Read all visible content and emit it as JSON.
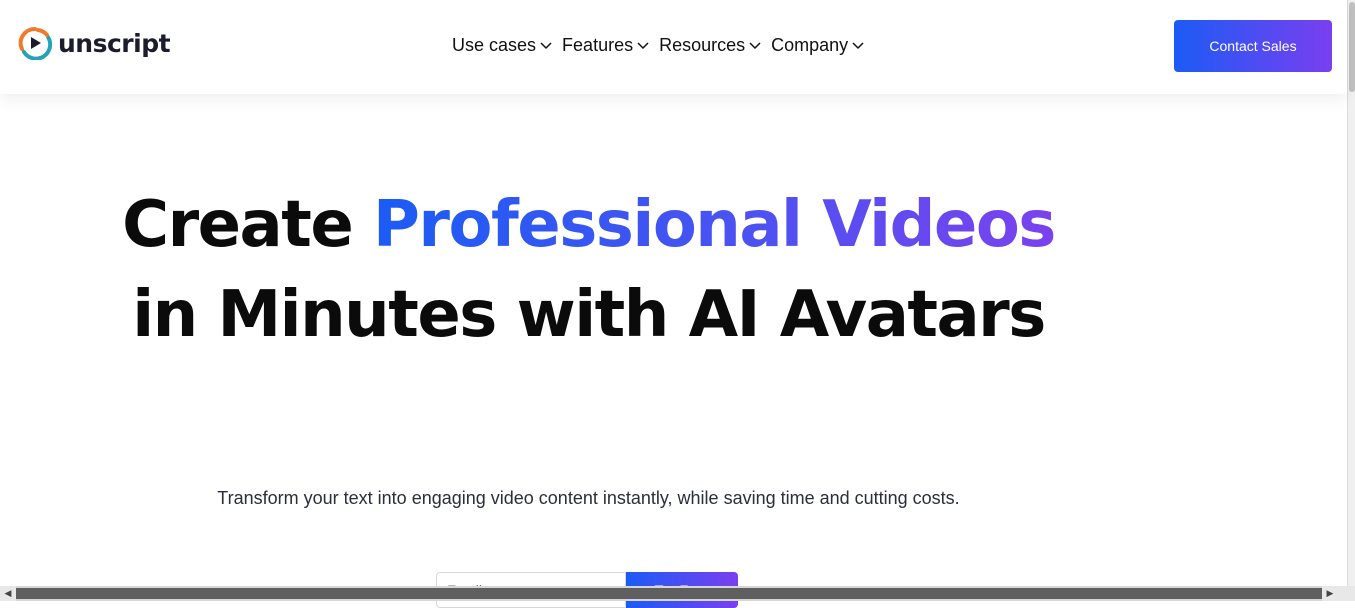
{
  "brand": {
    "name": "unscript",
    "logo_icon": "play-circle-icon",
    "colors": {
      "orange": "#f07a2b",
      "teal": "#23a3b3",
      "dark": "#1c1c2c"
    }
  },
  "nav": {
    "items": [
      {
        "label": "Use cases",
        "icon": "chevron-down-icon"
      },
      {
        "label": "Features",
        "icon": "chevron-down-icon"
      },
      {
        "label": "Resources",
        "icon": "chevron-down-icon"
      },
      {
        "label": "Company",
        "icon": "chevron-down-icon"
      }
    ]
  },
  "header": {
    "cta_label": "Contact Sales"
  },
  "hero": {
    "line1_plain": "Create ",
    "line1_highlight": "Professional Videos",
    "line2": "in Minutes with AI Avatars",
    "subtitle": "Transform your text into engaging video content instantly, while saving time and cutting costs.",
    "gradient": {
      "start": "#1b5cf4",
      "end": "#7a42ee"
    }
  },
  "signup": {
    "email_placeholder": "Email",
    "button_label": "Try Free"
  },
  "scrollbars": {
    "left_arrow": "◀",
    "right_arrow": "▶"
  }
}
